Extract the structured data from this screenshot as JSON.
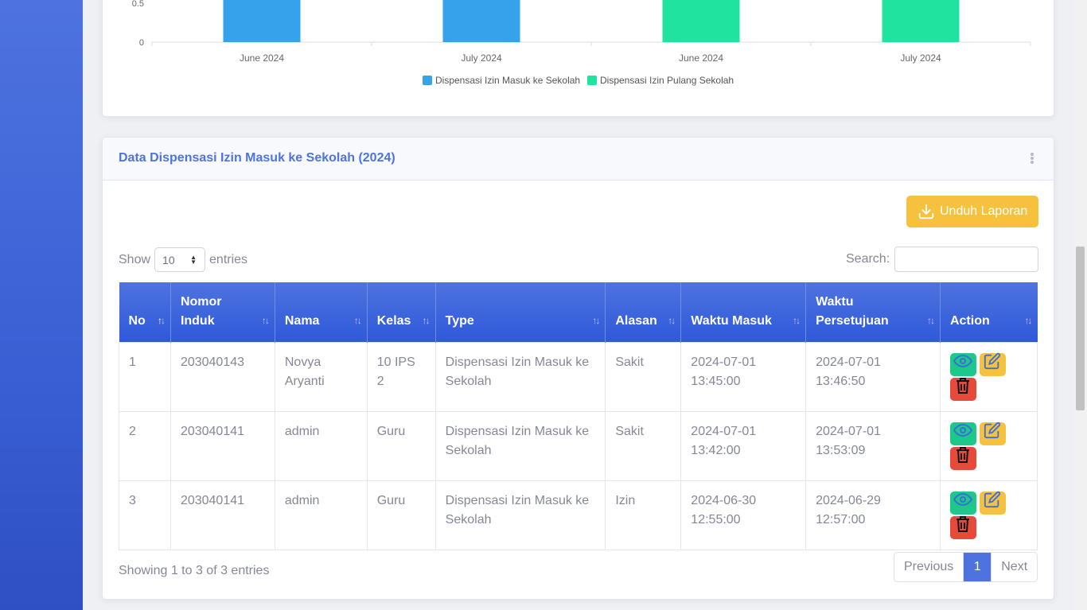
{
  "chart_data": {
    "type": "bar",
    "categories": [
      "June 2024",
      "July 2024",
      "June 2024",
      "July 2024"
    ],
    "series": [
      {
        "name": "Dispensasi Izin Masuk ke Sekolah",
        "values": [
          1,
          1,
          0,
          0
        ],
        "color": "#36a2eb"
      },
      {
        "name": "Dispensasi Izin Pulang Sekolah",
        "values": [
          0,
          0,
          1,
          1
        ],
        "color": "#20e3a0"
      }
    ],
    "y_ticks": [
      "0",
      "0.5"
    ],
    "legend_position": "bottom",
    "grid": false
  },
  "card": {
    "title": "Data Dispensasi Izin Masuk ke Sekolah (2024)",
    "download_label": "Unduh Laporan"
  },
  "controls": {
    "show_label": "Show",
    "entries_label": "entries",
    "page_size": "10",
    "search_label": "Search:",
    "search_value": ""
  },
  "table": {
    "headers": [
      "No",
      "Nomor Induk",
      "Nama",
      "Kelas",
      "Type",
      "Alasan",
      "Waktu Masuk",
      "Waktu Persetujuan",
      "Action"
    ],
    "rows": [
      {
        "no": "1",
        "nomor_induk": "203040143",
        "nama": "Novya Aryanti",
        "kelas": "10 IPS 2",
        "type": "Dispensasi Izin Masuk ke Sekolah",
        "alasan": "Sakit",
        "waktu_masuk": "2024-07-01 13:45:00",
        "waktu_persetujuan": "2024-07-01 13:46:50"
      },
      {
        "no": "2",
        "nomor_induk": "203040141",
        "nama": "admin",
        "kelas": "Guru",
        "type": "Dispensasi Izin Masuk ke Sekolah",
        "alasan": "Sakit",
        "waktu_masuk": "2024-07-01 13:42:00",
        "waktu_persetujuan": "2024-07-01 13:53:09"
      },
      {
        "no": "3",
        "nomor_induk": "203040141",
        "nama": "admin",
        "kelas": "Guru",
        "type": "Dispensasi Izin Masuk ke Sekolah",
        "alasan": "Izin",
        "waktu_masuk": "2024-06-30 12:55:00",
        "waktu_persetujuan": "2024-06-29 12:57:00"
      }
    ]
  },
  "footer": {
    "info": "Showing 1 to 3 of 3 entries",
    "prev": "Previous",
    "current_page": "1",
    "next": "Next"
  },
  "colors": {
    "primary": "#4e73df",
    "warning": "#f6c23e",
    "success": "#1cc88a",
    "danger": "#e74a3b"
  }
}
